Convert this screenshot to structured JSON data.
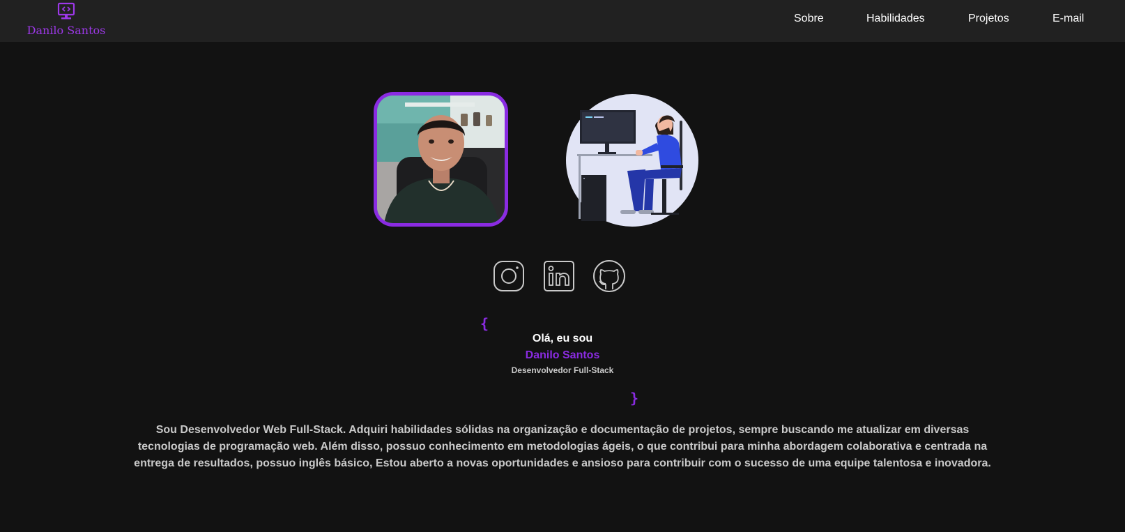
{
  "brand": {
    "name": "Danilo Santos",
    "icon": "monitor-code-icon",
    "accent_color": "#8a2be2"
  },
  "nav": {
    "items": [
      {
        "label": "Sobre"
      },
      {
        "label": "Habilidades"
      },
      {
        "label": "Projetos"
      },
      {
        "label": "E-mail"
      }
    ]
  },
  "hero": {
    "photo": "profile-photo",
    "illustration": "developer-at-desk-illustration",
    "socials": [
      {
        "icon": "instagram-icon"
      },
      {
        "icon": "linkedin-icon"
      },
      {
        "icon": "github-icon"
      }
    ],
    "brace_open": "{",
    "brace_close": "}",
    "greeting": "Olá, eu sou",
    "name": "Danilo Santos",
    "role": "Desenvolvedor Full-Stack"
  },
  "about": {
    "text": "Sou Desenvolvedor Web Full-Stack. Adquiri habilidades sólidas na organização e documentação de projetos, sempre buscando me atualizar em diversas tecnologias de programação web. Além disso, possuo conhecimento em metodologias ágeis, o que contribui para minha abordagem colaborativa e centrada na entrega de resultados, possuo inglês básico, Estou aberto a novas oportunidades e ansioso para contribuir com o sucesso de uma equipe talentosa e inovadora."
  },
  "colors": {
    "page_background": "#121212",
    "navbar_background": "#212121",
    "text_primary": "#ffffff",
    "text_secondary": "#c9c9c9"
  }
}
